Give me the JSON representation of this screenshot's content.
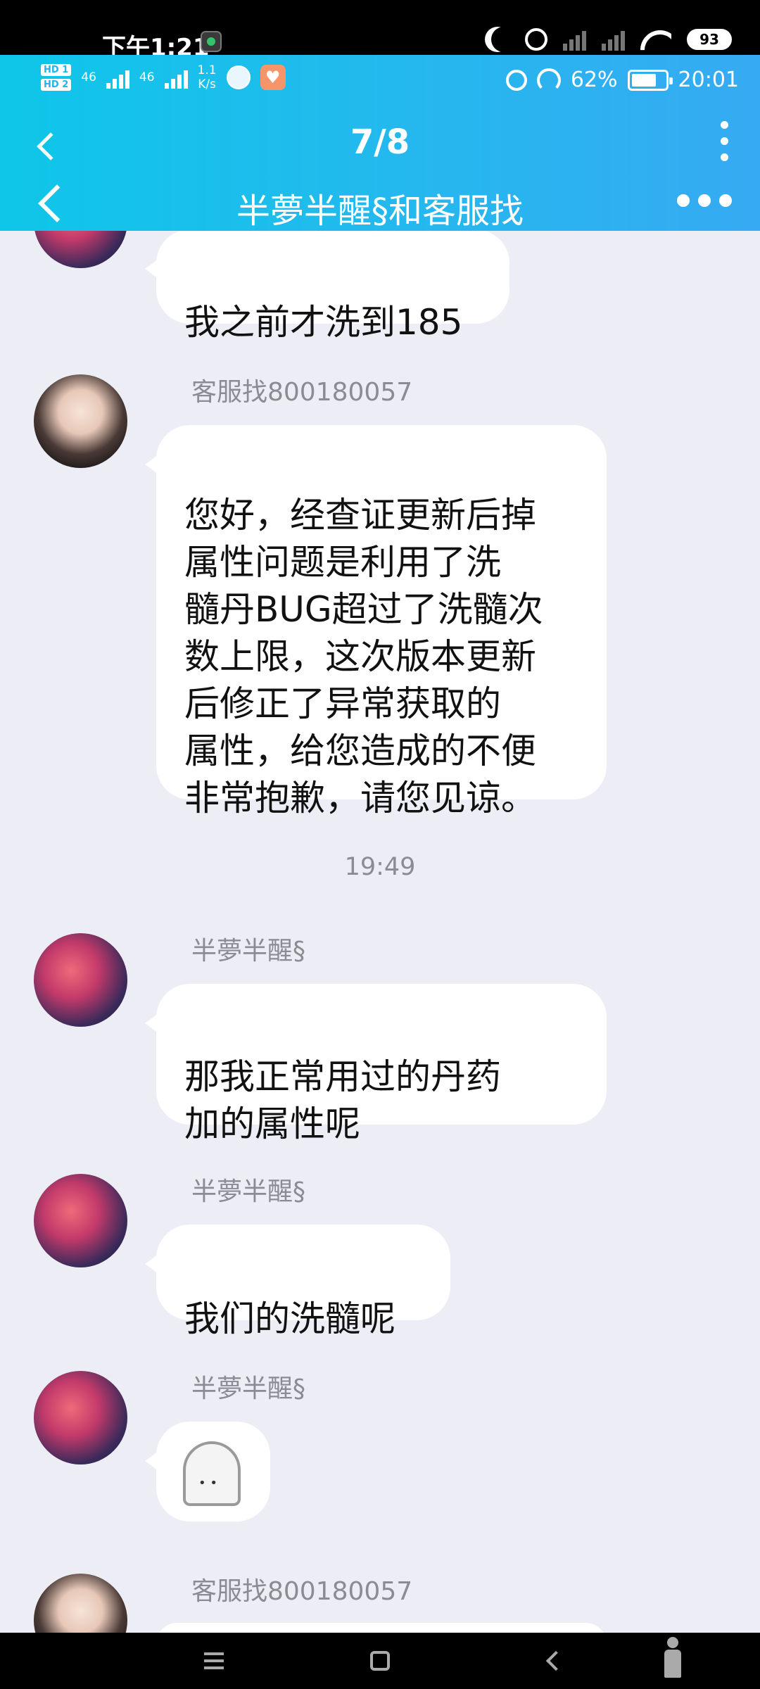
{
  "outer_status": {
    "time": "下午1:21",
    "battery": "93",
    "network": "HD"
  },
  "inner_status": {
    "hd1": "HD 1",
    "hd2": "HD 2",
    "net1": "46",
    "net2": "46",
    "speed": "1.1\nK/s",
    "battery_percent": "62%",
    "time": "20:01"
  },
  "viewer": {
    "page_counter": "7/8"
  },
  "chat": {
    "title": "半夢半醒§和客服找"
  },
  "messages": [
    {
      "sender": "",
      "avatar": "anime",
      "text": "我之前才洗到185"
    },
    {
      "sender": "客服找800180057",
      "avatar": "person",
      "text": "您好，经查证更新后掉\n属性问题是利用了洗\n髓丹BUG超过了洗髓次\n数上限，这次版本更新\n后修正了异常获取的\n属性，给您造成的不便\n非常抱歉，请您见谅。"
    },
    {
      "timestamp": "19:49"
    },
    {
      "sender": "半夢半醒§",
      "avatar": "anime",
      "text": "那我正常用过的丹药\n加的属性呢"
    },
    {
      "sender": "半夢半醒§",
      "avatar": "anime",
      "text": "我们的洗髓呢"
    },
    {
      "sender": "半夢半醒§",
      "avatar": "anime",
      "sticker": "ghost-sticker"
    },
    {
      "sender": "客服找800180057",
      "avatar": "person",
      "text": ""
    }
  ],
  "colors": {
    "header_start": "#0ec6e8",
    "header_end": "#36aaf2",
    "chat_bg": "#ededf5",
    "bubble_bg": "#ffffff",
    "sender_text": "#8a8c93"
  }
}
